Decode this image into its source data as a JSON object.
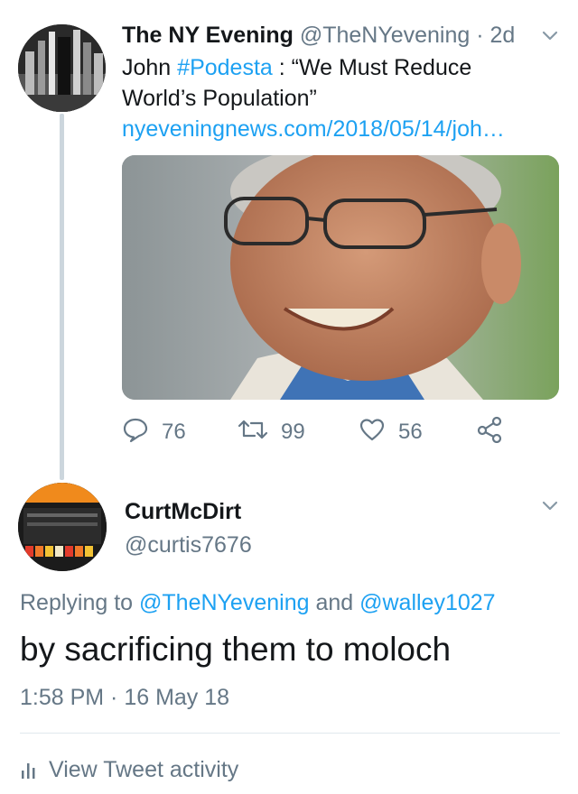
{
  "tweet1": {
    "display_name": "The NY Evening",
    "handle": "@TheNYevening",
    "separator": "·",
    "age": "2d",
    "text_before": "John ",
    "hashtag": "#Podesta",
    "text_after": " : “We Must Reduce World’s Population”",
    "link": "nyeveningnews.com/2018/05/14/joh…",
    "replies": "76",
    "retweets": "99",
    "likes": "56",
    "accent_color": "#1da1f2"
  },
  "tweet2": {
    "display_name": "CurtMcDirt",
    "handle": "@curtis7676",
    "replying_prefix": "Replying to ",
    "mention1": "@TheNYevening",
    "and_word": " and ",
    "mention2": "@walley1027",
    "text": "by sacrificing them to moloch",
    "time": "1:58 PM",
    "separator": " · ",
    "date": "16 May 18"
  },
  "footer": {
    "activity_label": "View Tweet activity"
  },
  "icons": [
    "reply-icon",
    "retweet-icon",
    "like-icon",
    "share-icon",
    "chevron-down-icon",
    "activity-icon"
  ]
}
